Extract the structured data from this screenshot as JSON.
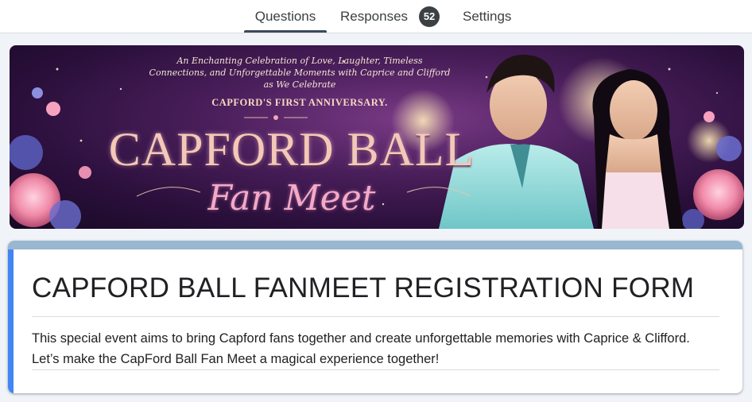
{
  "tabs": {
    "questions": "Questions",
    "responses": "Responses",
    "responses_count": "52",
    "settings": "Settings"
  },
  "banner": {
    "tagline": "An Enchanting Celebration of Love, Laughter, Timeless Connections, and Unforgettable Moments with Caprice and Clifford as We Celebrate",
    "tagline_caps": "CAPFORD'S FIRST ANNIVERSARY.",
    "title": "CAPFORD BALL",
    "subtitle": "Fan Meet"
  },
  "form": {
    "title": "CAPFORD BALL FANMEET REGISTRATION FORM",
    "description": "This special event aims to bring Capford fans together and create unforgettable memories with Caprice & Clifford. Let’s make the CapFord Ball Fan Meet a magical experience together!"
  },
  "colors": {
    "accent": "#4285f4",
    "header_band": "#98b7d1",
    "page_bg": "#f0f4f9"
  }
}
